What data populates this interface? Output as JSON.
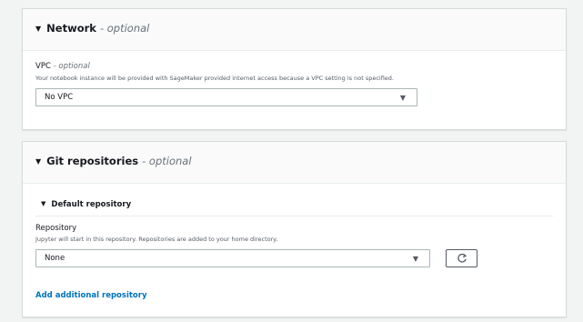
{
  "network": {
    "title": "Network",
    "optional_label": "- optional",
    "vpc": {
      "label": "VPC",
      "optional_label": "- optional",
      "description": "Your notebook instance will be provided with SageMaker provided internet access because a VPC setting is not specified.",
      "value": "No VPC"
    }
  },
  "git": {
    "title": "Git repositories",
    "optional_label": "- optional",
    "default_repository": {
      "title": "Default repository",
      "repository_label": "Repository",
      "repository_description": "Jupyter will start in this repository. Repositories are added to your home directory.",
      "value": "None"
    },
    "add_link": "Add additional repository"
  },
  "icons": {
    "expand": "caret-down-icon",
    "dropdown": "dropdown-caret-icon",
    "refresh": "refresh-icon"
  }
}
